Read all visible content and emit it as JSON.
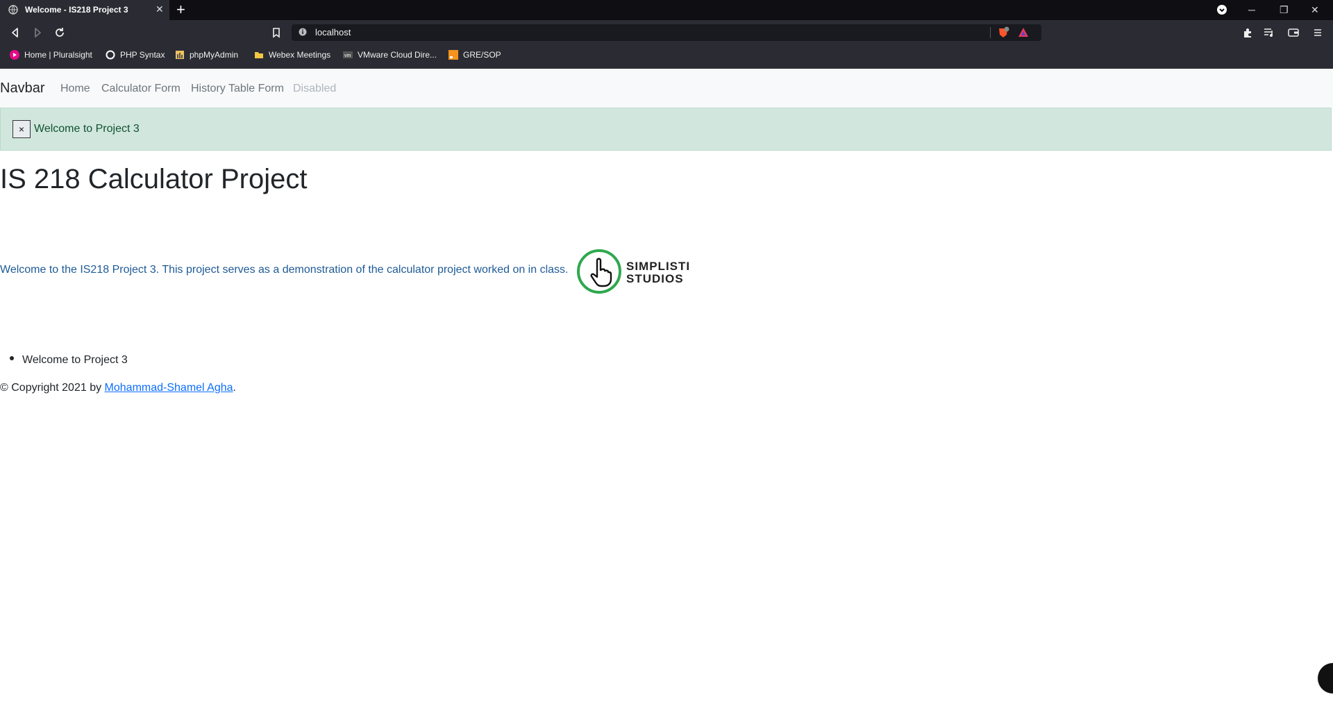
{
  "browser": {
    "tab_title": "Welcome - IS218 Project 3",
    "tab_close": "✕",
    "new_tab": "+",
    "url": "localhost",
    "window_controls": {
      "minimize": "─",
      "restore": "❐",
      "close": "✕"
    },
    "bookmarks": [
      {
        "label": "Home | Pluralsight",
        "icon": "pluralsight-icon"
      },
      {
        "label": "PHP Syntax",
        "icon": "circle-icon"
      },
      {
        "label": "phpMyAdmin",
        "icon": "phpmyadmin-icon"
      },
      {
        "label": "Webex Meetings",
        "icon": "folder-icon"
      },
      {
        "label": "VMware Cloud Dire...",
        "icon": "vmware-icon"
      },
      {
        "label": "GRE/SOP",
        "icon": "bookmark-orange-icon"
      }
    ]
  },
  "page": {
    "navbar": {
      "brand": "Navbar",
      "links": [
        "Home",
        "Calculator Form",
        "History Table Form",
        "Disabled"
      ]
    },
    "alert": {
      "close": "×",
      "message": "Welcome to Project 3"
    },
    "heading": "IS 218 Calculator Project",
    "lead": "Welcome to the IS218 Project 3. This project serves as a demonstration of the calculator project worked on in class.",
    "logo": {
      "line1": "SIMPLISTI",
      "line2": "STUDIOS"
    },
    "list": [
      "Welcome to Project 3"
    ],
    "footer": {
      "prefix": "© Copyright 2021 by ",
      "author": "Mohammad-Shamel Agha",
      "suffix": "."
    }
  },
  "colors": {
    "alert_bg": "#d1e7dd",
    "alert_text": "#0f5132",
    "link": "#0d6efd",
    "logo_green": "#2fa84f"
  }
}
